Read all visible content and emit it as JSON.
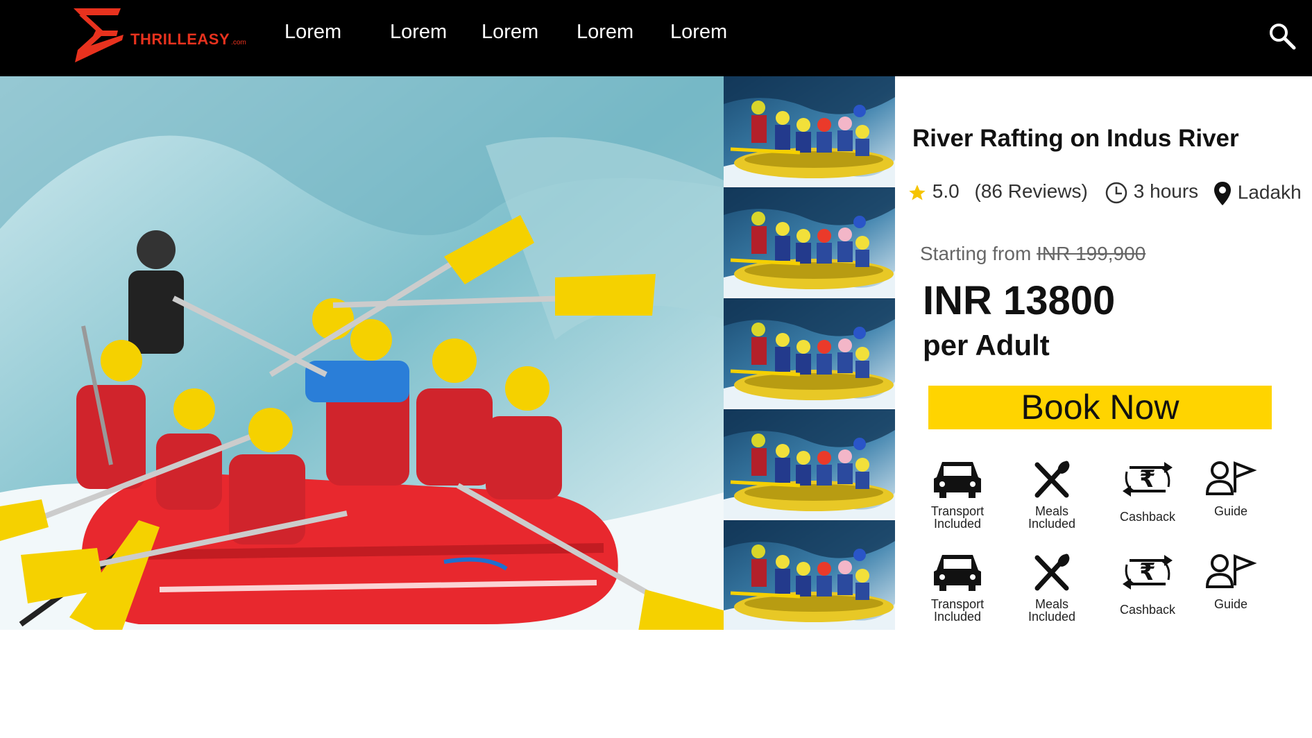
{
  "brand": {
    "name": "THRILLEASY",
    "suffix": ".com"
  },
  "nav": [
    "Lorem",
    "Lorem",
    "Lorem",
    "Lorem",
    "Lorem"
  ],
  "hero": {
    "icon": "rafting-photo"
  },
  "product": {
    "title": "River Rafting on Indus River",
    "rating": "5.0",
    "reviews": "(86 Reviews)",
    "duration": "3 hours",
    "location": "Ladakh",
    "starting_label": "Starting from",
    "original_price": "INR 199,900",
    "price": "INR 13800",
    "per": "per Adult",
    "book_label": "Book Now"
  },
  "features_row1": [
    {
      "label": "Transport\nIncluded",
      "icon": "car-icon"
    },
    {
      "label": "Meals\nIncluded",
      "icon": "meals-icon"
    },
    {
      "label": "Cashback",
      "icon": "cashback-icon"
    },
    {
      "label": "Guide",
      "icon": "guide-icon"
    }
  ],
  "features_row2": [
    {
      "label": "Transport\nIncluded",
      "icon": "car-icon"
    },
    {
      "label": "Meals\nIncluded",
      "icon": "meals-icon"
    },
    {
      "label": "Cashback",
      "icon": "cashback-icon"
    },
    {
      "label": "Guide",
      "icon": "guide-icon"
    }
  ],
  "colors": {
    "accent": "#ffd400",
    "brand": "#e8321e",
    "topbar": "#000000"
  }
}
